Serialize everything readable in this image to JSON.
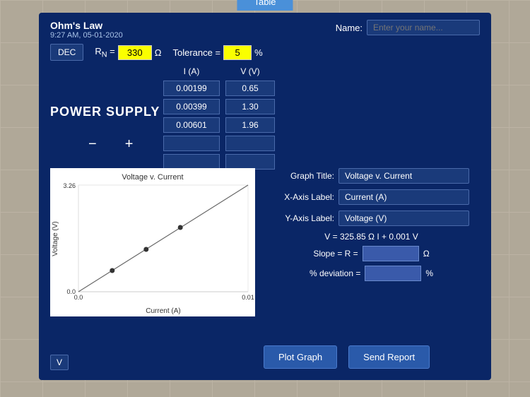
{
  "tab": {
    "label": "Table"
  },
  "header": {
    "title": "Ohm's Law",
    "subtitle": "9:27 AM, 05-01-2020",
    "name_label": "Name:",
    "name_placeholder": "Enter your name..."
  },
  "controls": {
    "dec_label": "DEC",
    "rn_label": "R",
    "rn_subscript": "N",
    "rn_value": "330",
    "rn_unit": "Ω",
    "tolerance_label": "Tolerance =",
    "tolerance_value": "5",
    "tolerance_unit": "%"
  },
  "table": {
    "col_i_label": "I (A)",
    "col_v_label": "V (V)",
    "rows": [
      {
        "i": "0.00199",
        "v": "0.65"
      },
      {
        "i": "0.00399",
        "v": "1.30"
      },
      {
        "i": "0.00601",
        "v": "1.96"
      },
      {
        "i": "",
        "v": ""
      },
      {
        "i": "",
        "v": ""
      }
    ]
  },
  "power_supply_label": "POWER SUPPLY",
  "graph": {
    "title": "Voltage v. Current",
    "x_min": "0.0",
    "x_max": "0.01",
    "y_min": "0.0",
    "y_max": "3.26",
    "x_label": "Current (A)",
    "y_label": "Voltage (V)"
  },
  "settings": {
    "graph_title_label": "Graph Title:",
    "graph_title_value": "Voltage v. Current",
    "x_axis_label": "X-Axis Label:",
    "x_axis_value": "Current (A)",
    "y_axis_label": "Y-Axis Label:",
    "y_axis_value": "Voltage (V)"
  },
  "equation": {
    "text": "V =  325.85 Ω I  +    0.001 V"
  },
  "slope": {
    "label": "Slope = R =",
    "value": "",
    "unit": "Ω"
  },
  "deviation": {
    "label": "% deviation =",
    "value": "",
    "unit": "%"
  },
  "buttons": {
    "plot_graph": "Plot Graph",
    "send_report": "Send Report"
  },
  "v_badge": "V"
}
